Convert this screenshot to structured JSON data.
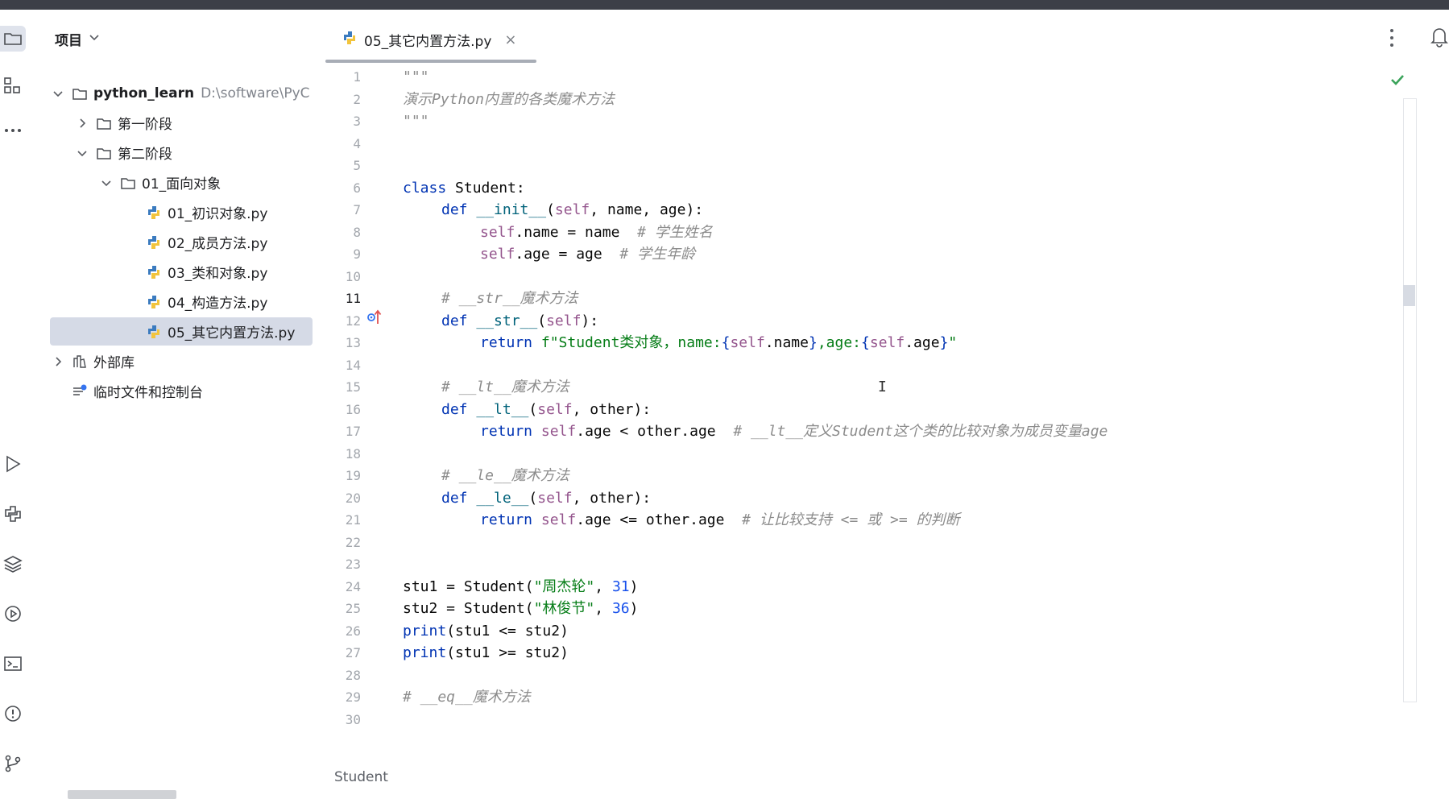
{
  "project": {
    "title": "项目",
    "root": {
      "name": "python_learn",
      "path": "D:\\software\\PyC"
    },
    "items": [
      {
        "label": "第一阶段"
      },
      {
        "label": "第二阶段"
      },
      {
        "label": "01_面向对象"
      },
      {
        "label": "01_初识对象.py"
      },
      {
        "label": "02_成员方法.py"
      },
      {
        "label": "03_类和对象.py"
      },
      {
        "label": "04_构造方法.py"
      },
      {
        "label": "05_其它内置方法.py",
        "selected": true
      },
      {
        "label": "外部库"
      },
      {
        "label": "临时文件和控制台"
      }
    ]
  },
  "editor": {
    "tab_label": "05_其它内置方法.py",
    "tab_close": "×",
    "current_line": 11,
    "line_numbers": [
      "1",
      "2",
      "3",
      "4",
      "5",
      "6",
      "7",
      "8",
      "9",
      "10",
      "11",
      "12",
      "13",
      "14",
      "15",
      "16",
      "17",
      "18",
      "19",
      "20",
      "21",
      "22",
      "23",
      "24",
      "25",
      "26",
      "27",
      "28",
      "29",
      "30"
    ],
    "code": {
      "l1": "\"\"\"",
      "l2": "演示Python内置的各类魔术方法",
      "l3": "\"\"\"",
      "l6a": "class",
      "l6b": " Student:",
      "l7a": "def",
      "l7b": "__init__",
      "l7c": "(",
      "l7d": "self",
      "l7e": ", name, age):",
      "l8a": "self",
      "l8b": ".name = name  ",
      "l8c": "# 学生姓名",
      "l9a": "self",
      "l9b": ".age = age  ",
      "l9c": "# 学生年龄",
      "l11": "# __str__魔术方法",
      "l12a": "def",
      "l12b": "__str__",
      "l12c": "(",
      "l12d": "self",
      "l12e": "):",
      "l13a": "return",
      "l13b": "f\"Student类对象，name:",
      "l13c": "{",
      "l13d": "self",
      "l13e": ".name",
      "l13f": "}",
      "l13g": ",age:",
      "l13h": "{",
      "l13i": "self",
      "l13j": ".age",
      "l13k": "}",
      "l13l": "\"",
      "l15": "# __lt__魔术方法",
      "l16a": "def",
      "l16b": "__lt__",
      "l16c": "(",
      "l16d": "self",
      "l16e": ", other):",
      "l17a": "return",
      "l17b": "self",
      "l17c": ".age < other.age  ",
      "l17d": "# __lt__定义Student这个类的比较对象为成员变量age",
      "l19": "# __le__魔术方法",
      "l20a": "def",
      "l20b": "__le__",
      "l20c": "(",
      "l20d": "self",
      "l20e": ", other):",
      "l21a": "return",
      "l21b": "self",
      "l21c": ".age <= other.age  ",
      "l21d": "# 让比较支持 <= 或 >= 的判断",
      "l24a": "stu1 = Student(",
      "l24b": "\"周杰轮\"",
      "l24c": ", ",
      "l24d": "31",
      "l24e": ")",
      "l25a": "stu2 = Student(",
      "l25b": "\"林俊节\"",
      "l25c": ", ",
      "l25d": "36",
      "l25e": ")",
      "l26a": "print",
      "l26b": "(stu1 <= stu2)",
      "l27a": "print",
      "l27b": "(stu1 >= stu2)",
      "l29": "# __eq__魔术方法"
    },
    "caret": "I",
    "breadcrumb": "Student"
  },
  "icons": {
    "toolstrip": [
      "folder-icon",
      "structure-icon",
      "more-icon",
      "run-icon",
      "python-console-icon",
      "layers-icon",
      "services-icon",
      "terminal-icon",
      "problems-icon",
      "git-icon"
    ]
  },
  "colors": {
    "keyword": "#0033b3",
    "self": "#94558d",
    "function": "#00627a",
    "string": "#067d17",
    "number": "#1750eb",
    "comment": "#8c8c8c",
    "selection": "#d5dae6"
  }
}
